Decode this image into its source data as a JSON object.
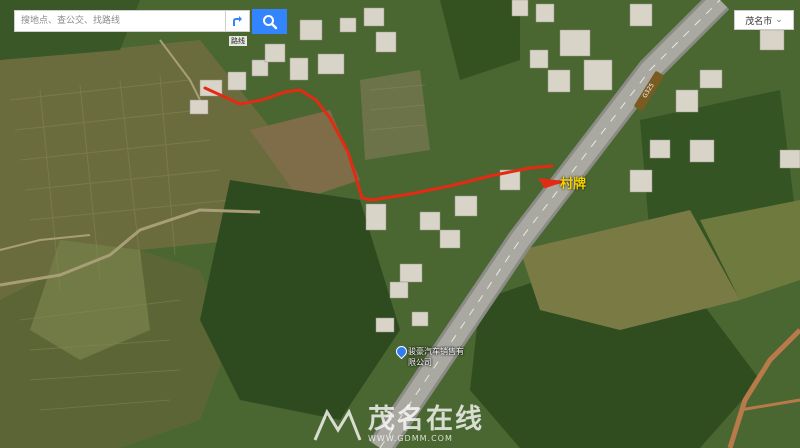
{
  "search": {
    "placeholder": "搜地点、查公交、找路线"
  },
  "toolbar": {
    "route_label": "路线",
    "search_icon": "search-icon",
    "route_icon": "directions-icon"
  },
  "city": {
    "name": "茂名市"
  },
  "map": {
    "road_label": "G325",
    "annotation": "村牌",
    "poi": {
      "name": "骏豪汽车销售有限公司"
    },
    "route_color": "#e32b14"
  },
  "watermark": {
    "brand": "茂名在线",
    "url": "WWW.GDMM.COM"
  }
}
